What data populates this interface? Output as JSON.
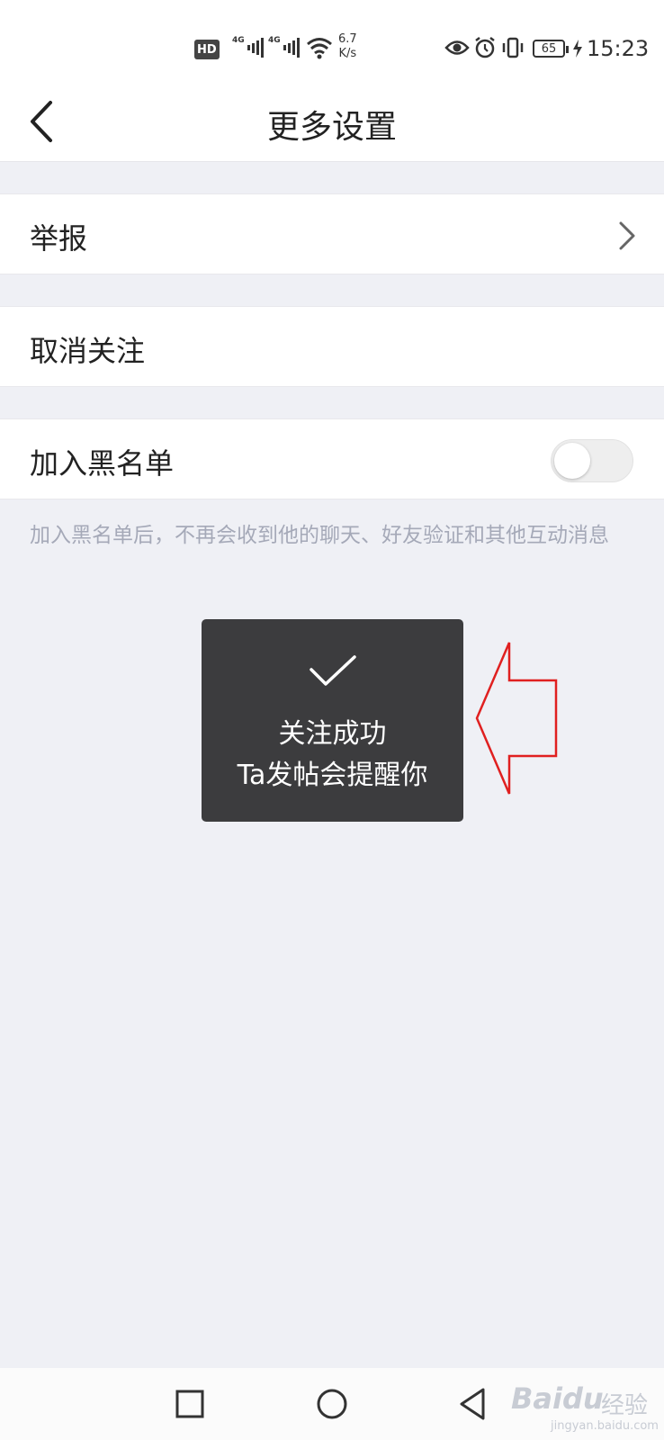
{
  "status_bar": {
    "hd_label": "HD",
    "network_1": "4G",
    "network_2": "4G",
    "net_speed_value": "6.7",
    "net_speed_unit": "K/s",
    "battery_level": "65",
    "time": "15:23",
    "icons": [
      "hd-icon",
      "signal-icon",
      "signal-icon",
      "wifi-icon",
      "eye-icon",
      "alarm-icon",
      "vibrate-icon",
      "battery-icon",
      "charging-icon"
    ]
  },
  "header": {
    "title": "更多设置",
    "back_icon": "back-arrow-icon"
  },
  "settings": {
    "report_label": "举报",
    "unfollow_label": "取消关注",
    "blacklist_label": "加入黑名单",
    "blacklist_enabled": false,
    "blacklist_hint": "加入黑名单后，不再会收到他的聊天、好友验证和其他互动消息"
  },
  "toast": {
    "icon": "checkmark-icon",
    "line1": "关注成功",
    "line2": "Ta发帖会提醒你"
  },
  "system_nav": {
    "icons": [
      "recent-apps-icon",
      "home-icon",
      "back-icon"
    ]
  },
  "watermark": {
    "logo": "Baidu",
    "cn": "经验",
    "url": "jingyan.baidu.com"
  },
  "colors": {
    "background": "#eff0f5",
    "toast_bg": "#3c3c3e",
    "annotation": "#e02020",
    "hint_text": "#a5a9b8"
  }
}
